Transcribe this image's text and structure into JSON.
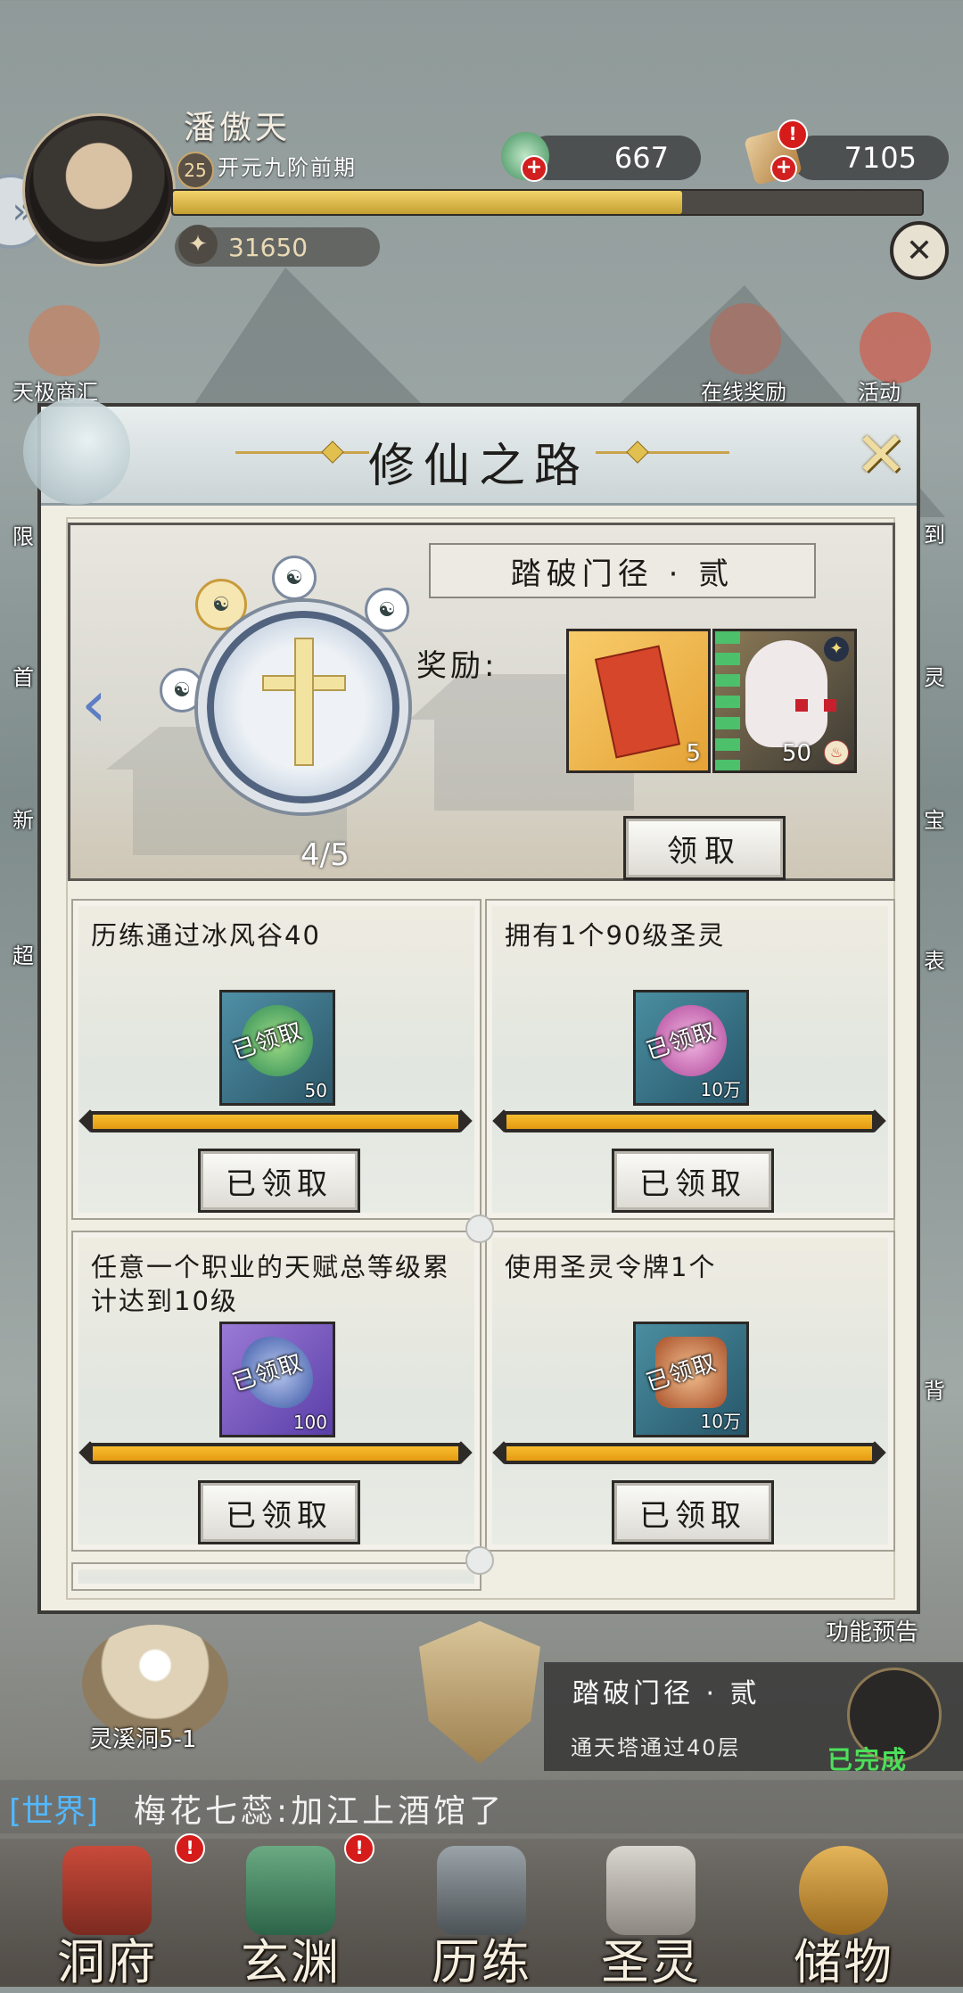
{
  "player": {
    "name": "潘傲天",
    "level": "25",
    "realm": "开元九阶前期",
    "exp_progress": 0.68,
    "power": "31650"
  },
  "currencies": [
    {
      "value": "667",
      "icon": "jade-icon"
    },
    {
      "value": "7105",
      "icon": "token-icon"
    }
  ],
  "side_left": [
    "天极商汇",
    "限",
    "首",
    "新",
    "超"
  ],
  "side_right": [
    "在线奖励",
    "活动",
    "到",
    "灵",
    "宝",
    "表",
    "背"
  ],
  "modal": {
    "title": "修仙之路",
    "stage": {
      "name": "踏破门径 · 贰",
      "progress": "4/5",
      "reward_label": "奖励:",
      "rewards": [
        {
          "count": "5",
          "icon": "red-scroll-icon"
        },
        {
          "count": "50",
          "icon": "spirit-creature-icon"
        }
      ],
      "claim_label": "领取"
    },
    "tasks": [
      {
        "title": "历练通过冰风谷40",
        "reward_count": "50",
        "stamp": "已领取",
        "progress": 1.0,
        "button": "已领取",
        "color": "#3f9a6a"
      },
      {
        "title": "拥有1个90级圣灵",
        "reward_count": "10万",
        "stamp": "已领取",
        "progress": 1.0,
        "button": "已领取",
        "color": "#c75a9e"
      },
      {
        "title": "任意一个职业的天赋总等级累计达到10级",
        "reward_count": "100",
        "stamp": "已领取",
        "progress": 1.0,
        "button": "已领取",
        "color": "#6b4fb8"
      },
      {
        "title": "使用圣灵令牌1个",
        "reward_count": "10万",
        "stamp": "已领取",
        "progress": 1.0,
        "button": "已领取",
        "color": "#b8643a"
      }
    ]
  },
  "bottom": {
    "feature_preview": "功能预告",
    "portal_label": "灵溪洞5-1",
    "quest": {
      "title": "踏破门径 · 贰",
      "desc": "通天塔通过40层",
      "status": "已完成"
    },
    "chat": {
      "channel": "[世界]",
      "message": "梅花七蕊:加江上酒馆了"
    },
    "nav": [
      "洞府",
      "玄渊",
      "历练",
      "圣灵",
      "储物"
    ]
  }
}
